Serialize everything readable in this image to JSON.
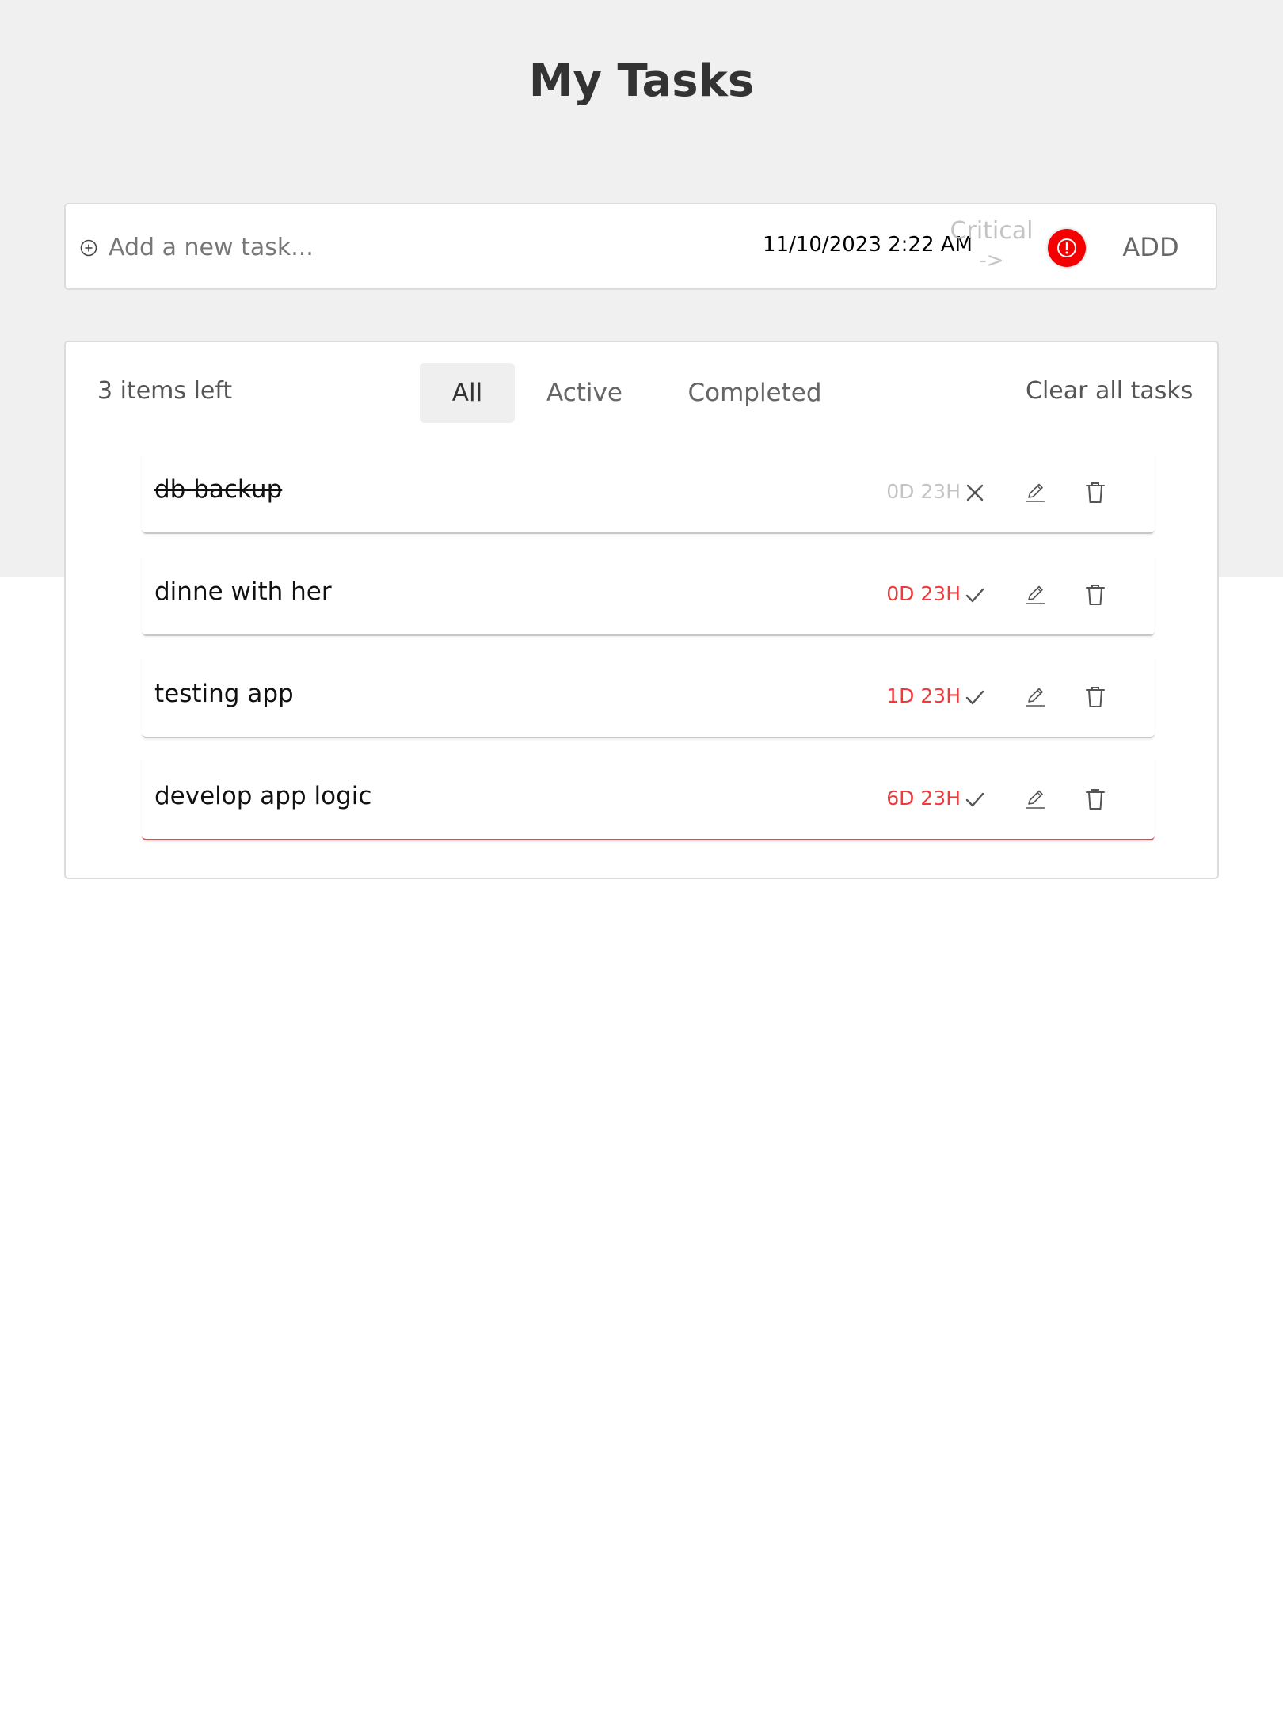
{
  "header": {
    "title": "My Tasks"
  },
  "composer": {
    "add_icon": "plus-circle-icon",
    "placeholder": "Add a new task...",
    "datetime": "11/10/2023 2:22 AM",
    "critical_label": "Critical",
    "critical_arrow": "->",
    "critical_icon": "exclamation-circle-icon",
    "critical_color": "#f40000",
    "add_label": "ADD"
  },
  "panel": {
    "items_left": "3 items left",
    "filters": {
      "all": "All",
      "active": "Active",
      "completed": "Completed",
      "selected": "All"
    },
    "clear_all": "Clear all tasks"
  },
  "tasks": [
    {
      "name": "db backup",
      "timer": "0D 23H",
      "completed": true,
      "critical": false,
      "toggle_icon": "close-icon"
    },
    {
      "name": "dinne with her",
      "timer": "0D 23H",
      "completed": false,
      "critical": false,
      "toggle_icon": "check-icon"
    },
    {
      "name": "testing app",
      "timer": "1D 23H",
      "completed": false,
      "critical": false,
      "toggle_icon": "check-icon"
    },
    {
      "name": "develop app logic",
      "timer": "6D 23H",
      "completed": false,
      "critical": true,
      "toggle_icon": "check-icon"
    }
  ],
  "colors": {
    "background_band": "#f0f0f0",
    "deadline_red": "#ef3b3b",
    "critical_border": "#e8474b",
    "muted": "#c4c4c4"
  }
}
